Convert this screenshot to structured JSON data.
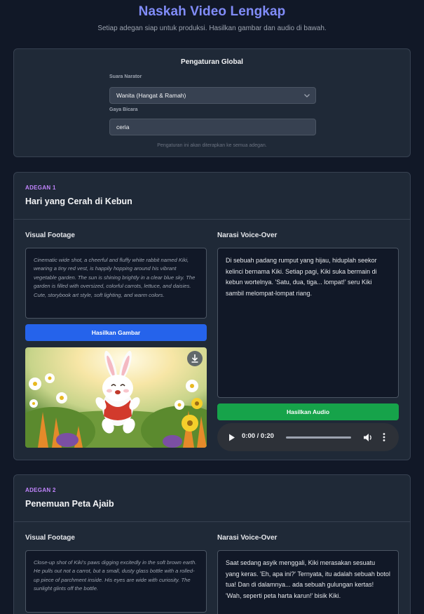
{
  "header": {
    "title": "Naskah Video Lengkap",
    "subtitle": "Setiap adegan siap untuk produksi. Hasilkan gambar dan audio di bawah."
  },
  "global_settings": {
    "title": "Pengaturan Global",
    "voice_label": "Suara Narator",
    "voice_value": "Wanita (Hangat & Ramah)",
    "style_label": "Gaya Bicara",
    "style_value": "ceria",
    "note": "Pengaturan ini akan diterapkan ke semua adegan."
  },
  "scenes": [
    {
      "number": "ADEGAN 1",
      "title": "Hari yang Cerah di Kebun",
      "visual_label": "Visual Footage",
      "visual_prompt": "Cinematic wide shot, a cheerful and fluffy white rabbit named Kiki, wearing a tiny red vest, is happily hopping around his vibrant vegetable garden. The sun is shining brightly in a clear blue sky. The garden is filled with oversized, colorful carrots, lettuce, and daisies. Cute, storybook art style, soft lighting, and warm colors.",
      "generate_image_label": "Hasilkan Gambar",
      "narration_label": "Narasi Voice-Over",
      "narration_text": "Di sebuah padang rumput yang hijau, hiduplah seekor kelinci bernama Kiki. Setiap pagi, Kiki suka bermain di kebun wortelnya. 'Satu, dua, tiga... lompat!' seru Kiki sambil melompat-lompat riang.",
      "generate_audio_label": "Hasilkan Audio",
      "audio_time": "0:00 / 0:20"
    },
    {
      "number": "ADEGAN 2",
      "title": "Penemuan Peta Ajaib",
      "visual_label": "Visual Footage",
      "visual_prompt": "Close-up shot of Kiki's paws digging excitedly in the soft brown earth. He pulls out not a carrot, but a small, dusty glass bottle with a rolled-up piece of parchment inside. His eyes are wide with curiosity. The sunlight glints off the bottle.",
      "narration_label": "Narasi Voice-Over",
      "narration_text": "Saat sedang asyik menggali, Kiki merasakan sesuatu yang keras. 'Eh, apa ini?' Ternyata, itu adalah sebuah botol tua! Dan di dalamnya... ada sebuah gulungan kertas! 'Wah, seperti peta harta karun!' bisik Kiki."
    }
  ],
  "colors": {
    "background": "#111827",
    "card": "#1f2937",
    "title_accent": "#818cf8",
    "scene_label": "#c084fc",
    "image_button": "#2563eb",
    "audio_button": "#16a34a"
  },
  "icons": [
    "chevron-down-icon",
    "download-icon",
    "play-icon",
    "volume-icon",
    "more-vertical-icon"
  ]
}
